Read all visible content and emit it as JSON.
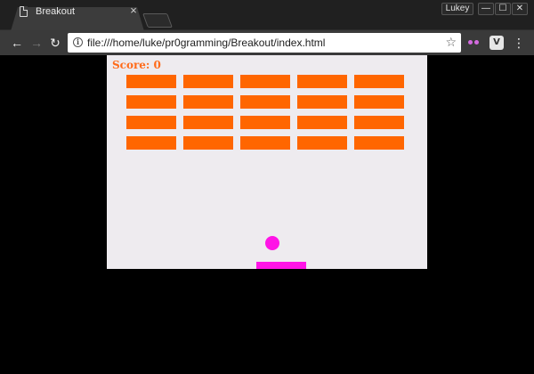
{
  "window": {
    "profile_name": "Lukey",
    "minimize_glyph": "—",
    "maximize_glyph": "☐",
    "close_glyph": "✕"
  },
  "tab": {
    "title": "Breakout",
    "close_glyph": "×",
    "icon": "page-icon"
  },
  "toolbar": {
    "back_glyph": "←",
    "forward_glyph": "→",
    "reload_glyph": "↻",
    "info_glyph": "i",
    "url": "file:///home/luke/pr0gramming/Breakout/index.html",
    "star_glyph": "☆",
    "extension2_label": "V",
    "menu_glyph": "⋮"
  },
  "game": {
    "score_text": "Score: 0",
    "brick_rows": 4,
    "brick_columns": 5,
    "brick_color": "#ff6600",
    "ball_color": "#ff14e6",
    "paddle_color": "#ff14e6",
    "canvas_color": "#eeebef",
    "score_color": "#ff6b1a"
  }
}
